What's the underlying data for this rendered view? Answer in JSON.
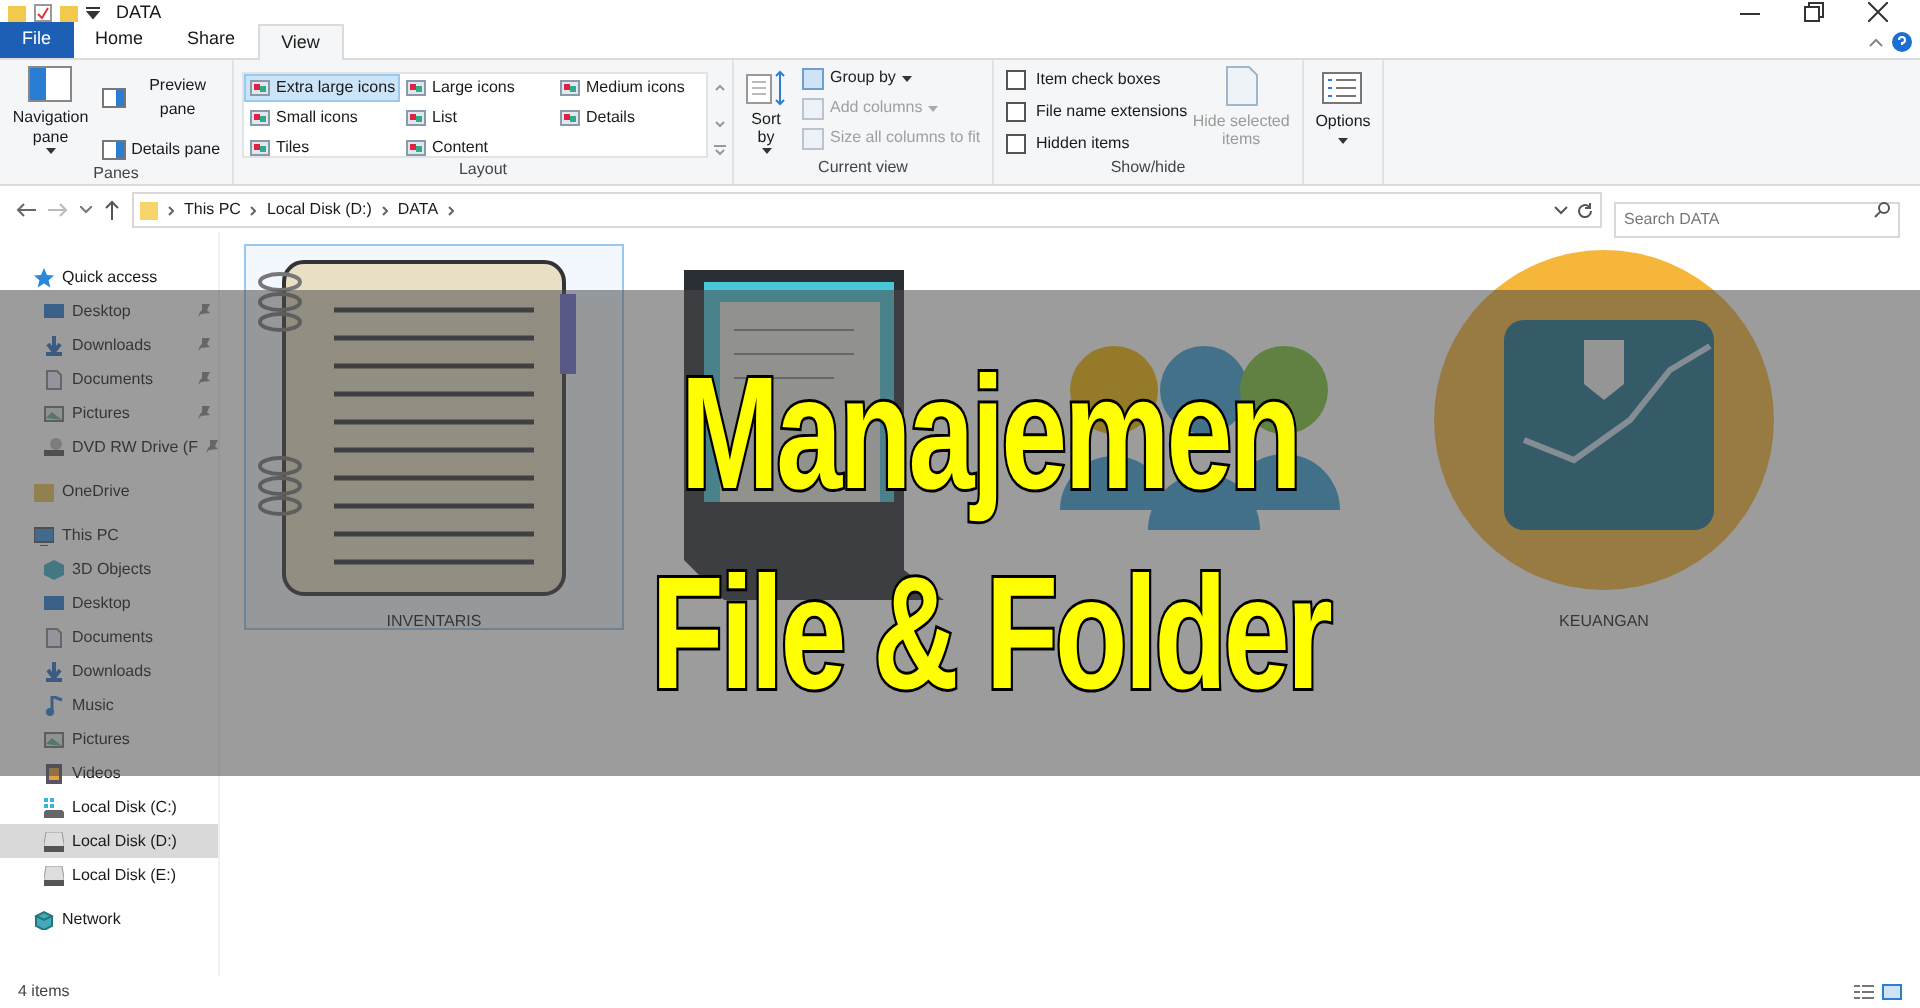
{
  "window": {
    "title": "DATA"
  },
  "tabs": [
    {
      "label": "File",
      "selected": false,
      "kind": "file"
    },
    {
      "label": "Home",
      "selected": false,
      "kind": "tab"
    },
    {
      "label": "Share",
      "selected": false,
      "kind": "tab"
    },
    {
      "label": "View",
      "selected": true,
      "kind": "tab"
    }
  ],
  "ribbon": {
    "panes": {
      "label": "Panes",
      "navigation": "Navigation pane",
      "items": [
        "Preview pane",
        "Details pane"
      ]
    },
    "layout": {
      "label": "Layout",
      "options": [
        {
          "label": "Extra large icons",
          "selected": true
        },
        {
          "label": "Large icons",
          "selected": false
        },
        {
          "label": "Medium icons",
          "selected": false
        },
        {
          "label": "Small icons",
          "selected": false
        },
        {
          "label": "List",
          "selected": false
        },
        {
          "label": "Details",
          "selected": false
        },
        {
          "label": "Tiles",
          "selected": false
        },
        {
          "label": "Content",
          "selected": false
        }
      ]
    },
    "current_view": {
      "label": "Current view",
      "sort": "Sort by",
      "items": [
        {
          "label": "Group by",
          "disabled": false
        },
        {
          "label": "Add columns",
          "disabled": true
        },
        {
          "label": "Size all columns to fit",
          "disabled": true
        }
      ]
    },
    "show_hide": {
      "label": "Show/hide",
      "checkboxes": [
        {
          "label": "Item check boxes",
          "checked": false
        },
        {
          "label": "File name extensions",
          "checked": false
        },
        {
          "label": "Hidden items",
          "checked": false
        }
      ],
      "hide_selected": {
        "label": "Hide selected items",
        "disabled": true
      }
    },
    "options": {
      "label": "Options"
    }
  },
  "address": {
    "crumbs": [
      "This PC",
      "Local Disk (D:)",
      "DATA"
    ],
    "search_placeholder": "Search DATA"
  },
  "sidebar": {
    "items": [
      {
        "label": "Quick access",
        "selected": false,
        "children": [
          {
            "label": "Desktop",
            "pinned": true,
            "selected": false
          },
          {
            "label": "Downloads",
            "pinned": true,
            "selected": false
          },
          {
            "label": "Documents",
            "pinned": true,
            "selected": false
          },
          {
            "label": "Pictures",
            "pinned": true,
            "selected": false
          },
          {
            "label": "DVD RW Drive (F",
            "pinned": true,
            "selected": false
          }
        ]
      },
      {
        "label": "OneDrive",
        "selected": false
      },
      {
        "label": "This PC",
        "selected": false,
        "children": [
          {
            "label": "3D Objects",
            "pinned": false,
            "selected": false
          },
          {
            "label": "Desktop",
            "pinned": false,
            "selected": false
          },
          {
            "label": "Documents",
            "pinned": false,
            "selected": false
          },
          {
            "label": "Downloads",
            "pinned": false,
            "selected": false
          },
          {
            "label": "Music",
            "pinned": false,
            "selected": false
          },
          {
            "label": "Pictures",
            "pinned": false,
            "selected": false
          },
          {
            "label": "Videos",
            "pinned": false,
            "selected": false
          },
          {
            "label": "Local Disk (C:)",
            "pinned": false,
            "selected": false
          },
          {
            "label": "Local Disk (D:)",
            "pinned": false,
            "selected": true
          },
          {
            "label": "Local Disk (E:)",
            "pinned": false,
            "selected": false
          }
        ]
      },
      {
        "label": "Network",
        "selected": false
      }
    ]
  },
  "files": [
    {
      "label": "INVENTARIS",
      "selected": true
    },
    {
      "selected": false
    },
    {
      "selected": false
    },
    {
      "label": "KEUANGAN",
      "selected": false
    }
  ],
  "banner": {
    "lines": [
      "Manajemen",
      "File & Folder"
    ]
  },
  "status_bar": {
    "count": "4 items"
  }
}
